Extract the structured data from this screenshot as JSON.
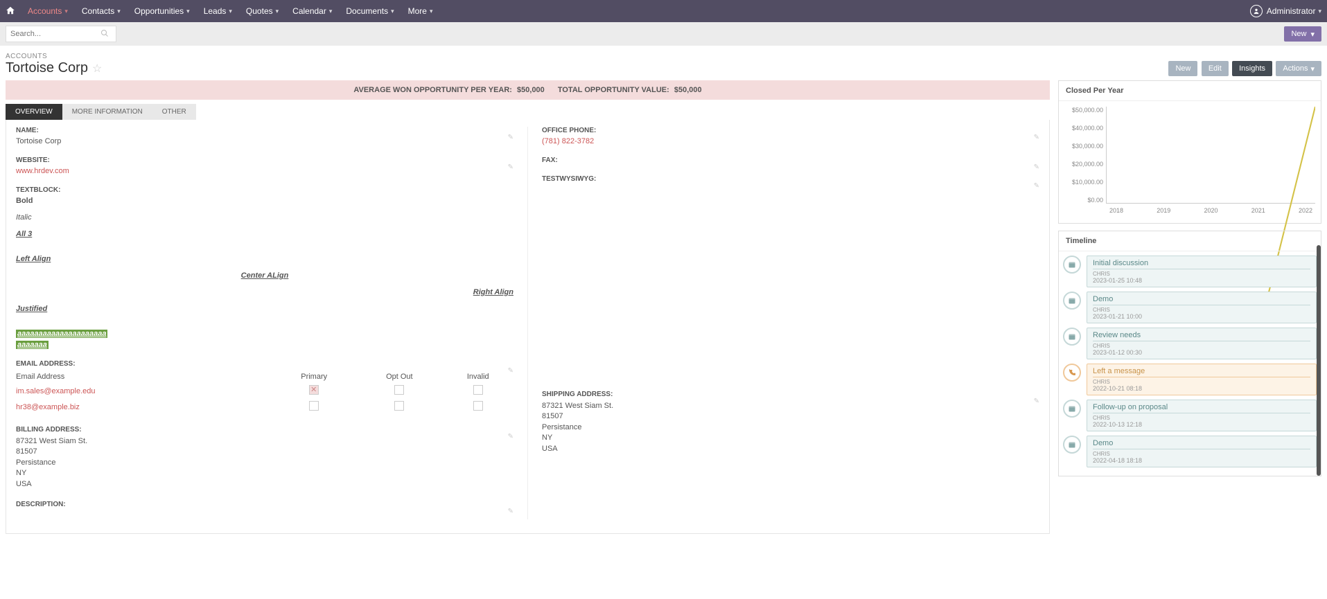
{
  "nav": {
    "items": [
      "Accounts",
      "Contacts",
      "Opportunities",
      "Leads",
      "Quotes",
      "Calendar",
      "Documents",
      "More"
    ],
    "active": "Accounts",
    "user": "Administrator"
  },
  "search": {
    "placeholder": "Search..."
  },
  "new_label": "New",
  "header": {
    "crumb": "ACCOUNTS",
    "title": "Tortoise Corp"
  },
  "actions": {
    "new": "New",
    "edit": "Edit",
    "insights": "Insights",
    "actions": "Actions"
  },
  "stats": {
    "avg_label": "AVERAGE WON OPPORTUNITY PER YEAR:",
    "avg_value": "$50,000",
    "total_label": "TOTAL OPPORTUNITY VALUE:",
    "total_value": "$50,000"
  },
  "tabs": [
    "OVERVIEW",
    "MORE INFORMATION",
    "OTHER"
  ],
  "fields": {
    "name_label": "NAME:",
    "name_value": "Tortoise Corp",
    "website_label": "WEBSITE:",
    "website_value": "www.hrdev.com",
    "textblock_label": "TEXTBLOCK:",
    "textblock": {
      "bold": "Bold",
      "italic": "Italic",
      "all3": "All 3",
      "left": "Left Align",
      "center": "Center ALign",
      "right": "Right Align",
      "justified": "Justified",
      "hl1": "aaaaaaaaaaaaaaaaaaaaa",
      "hl2": "aaaaaaa"
    },
    "phone_label": "OFFICE PHONE:",
    "phone_value": "(781) 822-3782",
    "fax_label": "FAX:",
    "testwys_label": "TESTWYSIWYG:",
    "email_label": "EMAIL ADDRESS:",
    "email_headers": {
      "addr": "Email Address",
      "primary": "Primary",
      "optout": "Opt Out",
      "invalid": "Invalid"
    },
    "emails": [
      {
        "addr": "im.sales@example.edu",
        "primary": true,
        "optout": false,
        "invalid": false
      },
      {
        "addr": "hr38@example.biz",
        "primary": false,
        "optout": false,
        "invalid": false
      }
    ],
    "billing_label": "BILLING ADDRESS:",
    "shipping_label": "SHIPPING ADDRESS:",
    "address": {
      "line1": "87321 West Siam St.",
      "line2": "81507",
      "line3": "Persistance",
      "line4": "NY",
      "line5": "USA"
    },
    "desc_label": "DESCRIPTION:"
  },
  "closed_card": {
    "title": "Closed Per Year"
  },
  "timeline_card": {
    "title": "Timeline"
  },
  "chart_data": {
    "type": "line",
    "title": "Closed Per Year",
    "xlabel": "",
    "ylabel": "",
    "ylim": [
      0,
      50000
    ],
    "y_ticks": [
      "$50,000.00",
      "$40,000.00",
      "$30,000.00",
      "$20,000.00",
      "$10,000.00",
      "$0.00"
    ],
    "categories": [
      "2018",
      "2019",
      "2020",
      "2021",
      "2022"
    ],
    "values": [
      0,
      0,
      0,
      0,
      50000
    ]
  },
  "timeline": [
    {
      "type": "meeting",
      "title": "Initial discussion",
      "author": "CHRIS",
      "date": "2023-01-25 10:48"
    },
    {
      "type": "meeting",
      "title": "Demo",
      "author": "CHRIS",
      "date": "2023-01-21 10:00"
    },
    {
      "type": "meeting",
      "title": "Review needs",
      "author": "CHRIS",
      "date": "2023-01-12 00:30"
    },
    {
      "type": "call",
      "title": "Left a message",
      "author": "CHRIS",
      "date": "2022-10-21 08:18"
    },
    {
      "type": "meeting",
      "title": "Follow-up on proposal",
      "author": "CHRIS",
      "date": "2022-10-13 12:18"
    },
    {
      "type": "meeting",
      "title": "Demo",
      "author": "CHRIS",
      "date": "2022-04-18 18:18"
    }
  ]
}
